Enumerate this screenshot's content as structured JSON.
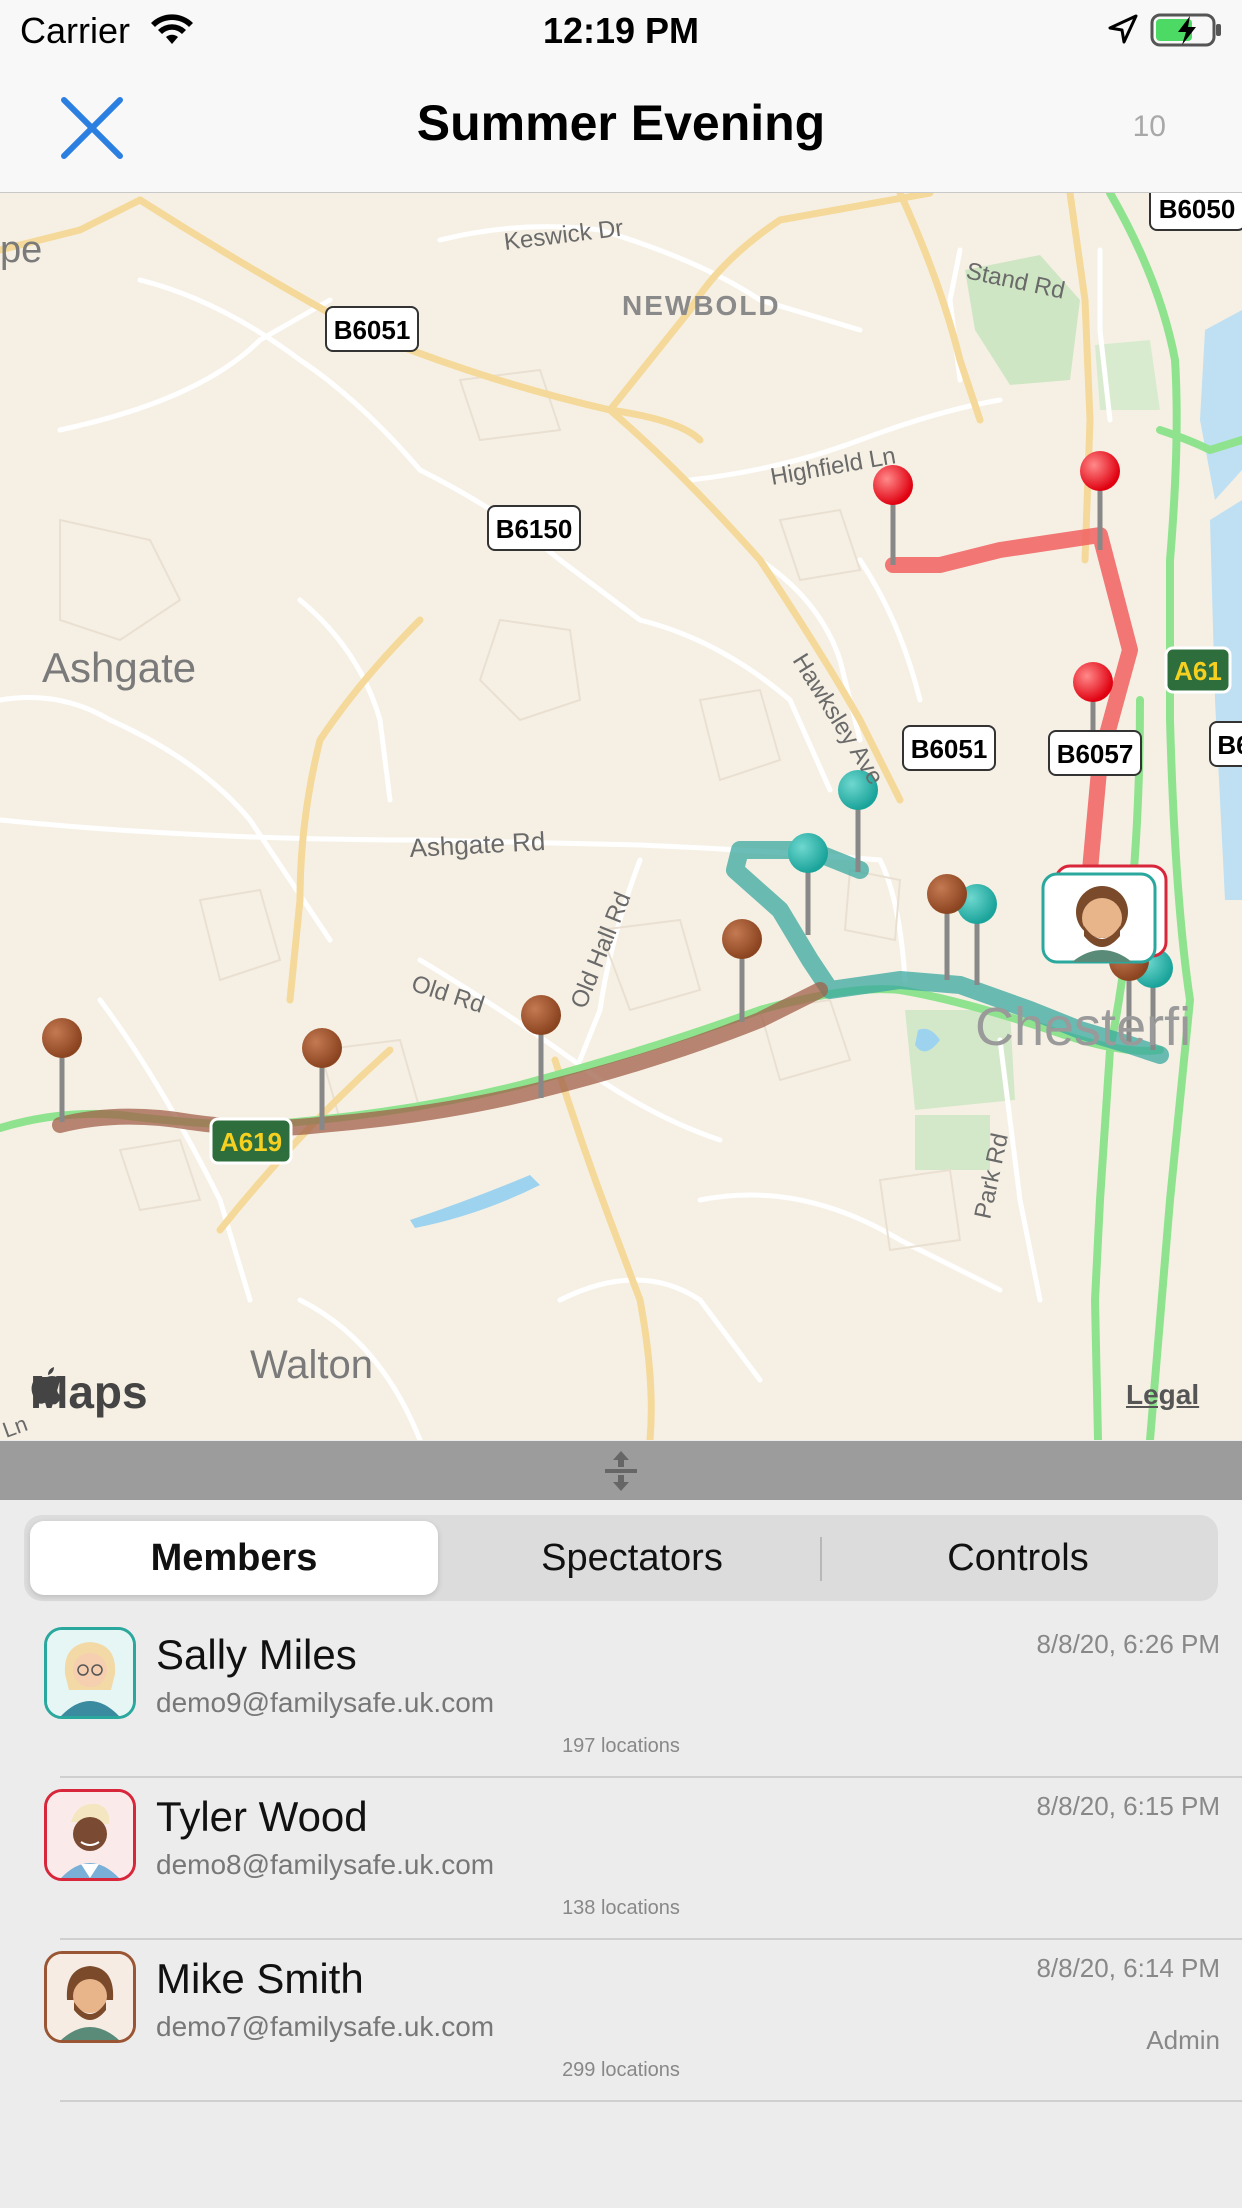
{
  "status_bar": {
    "carrier": "Carrier",
    "time": "12:19 PM"
  },
  "nav": {
    "title": "Summer Evening",
    "count": "10"
  },
  "map": {
    "place_labels": [
      {
        "text": "Keswick Dr"
      },
      {
        "text": "NEWBOLD"
      },
      {
        "text": "Stand Rd"
      },
      {
        "text": "Highfield Ln"
      },
      {
        "text": "Ashgate"
      },
      {
        "text": "Hawksley Ave"
      },
      {
        "text": "Ashgate Rd"
      },
      {
        "text": "Old Hall Rd"
      },
      {
        "text": "Old Rd"
      },
      {
        "text": "Chesterfi"
      },
      {
        "text": "Park Rd"
      },
      {
        "text": "Walton"
      },
      {
        "text": "pe"
      },
      {
        "text": "Ln"
      }
    ],
    "road_shields": [
      {
        "text": "B6050",
        "style": "white"
      },
      {
        "text": "B6051",
        "style": "white"
      },
      {
        "text": "B6150",
        "style": "white"
      },
      {
        "text": "A61",
        "style": "green"
      },
      {
        "text": "B6051",
        "style": "white"
      },
      {
        "text": "B6057",
        "style": "white"
      },
      {
        "text": "B6",
        "style": "white"
      },
      {
        "text": "A619",
        "style": "green"
      }
    ],
    "route_colors": {
      "red": "#f06060",
      "teal": "#3aa8a0",
      "brown": "#a0604a"
    },
    "maps_logo": "Maps",
    "legal": "Legal"
  },
  "segment": {
    "tabs": [
      "Members",
      "Spectators",
      "Controls"
    ],
    "selected": "Members"
  },
  "members": [
    {
      "name": "Sally Miles",
      "email": "demo9@familysafe.uk.com",
      "date": "8/8/20, 6:26 PM",
      "locations": "197  locations",
      "role": "",
      "color": "#2aa89e"
    },
    {
      "name": "Tyler Wood",
      "email": "demo8@familysafe.uk.com",
      "date": "8/8/20, 6:15 PM",
      "locations": "138  locations",
      "role": "",
      "color": "#d8263a"
    },
    {
      "name": "Mike Smith",
      "email": "demo7@familysafe.uk.com",
      "date": "8/8/20, 6:14 PM",
      "locations": "299  locations",
      "role": "Admin",
      "color": "#9a5634"
    }
  ]
}
